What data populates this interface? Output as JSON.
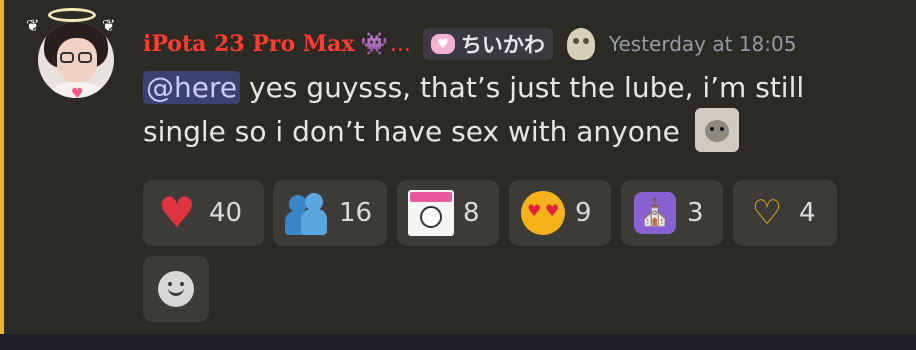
{
  "message": {
    "author": {
      "username": "iPota 23 Pro Max",
      "username_emoji": "👾",
      "truncation": "...",
      "username_color": "#ff3c2f",
      "avatar_icon": "avatar-with-halo",
      "tag": {
        "icon": "pink-heart-icon",
        "text": "ちいかわ"
      },
      "badge_icon": "skull-icon"
    },
    "timestamp": "Yesterday at 18:05",
    "content": {
      "mention": "@here",
      "text_line1": "yes guysss, that’s just the lube, i’m still",
      "text_line2": "single so i don’t have sex with anyone",
      "trailing_emoji": "custom-emoji-icon"
    }
  },
  "reactions": [
    {
      "icon": "red-heart-icon",
      "count": "40"
    },
    {
      "icon": "people-hugging-icon",
      "count": "16"
    },
    {
      "icon": "cat-sticker-icon",
      "count": "8"
    },
    {
      "icon": "hearts-face-icon",
      "count": "9"
    },
    {
      "icon": "praying-icon",
      "count": "3"
    },
    {
      "icon": "heart-hands-icon",
      "count": "4"
    }
  ],
  "add_reaction_icon": "smiley-icon",
  "colors": {
    "message_bg": "#2b2a25",
    "mention_bar": "#f0b232",
    "mention_bg": "#3c4270",
    "reaction_bg": "#3c3b37",
    "timestamp": "#949ba4"
  }
}
